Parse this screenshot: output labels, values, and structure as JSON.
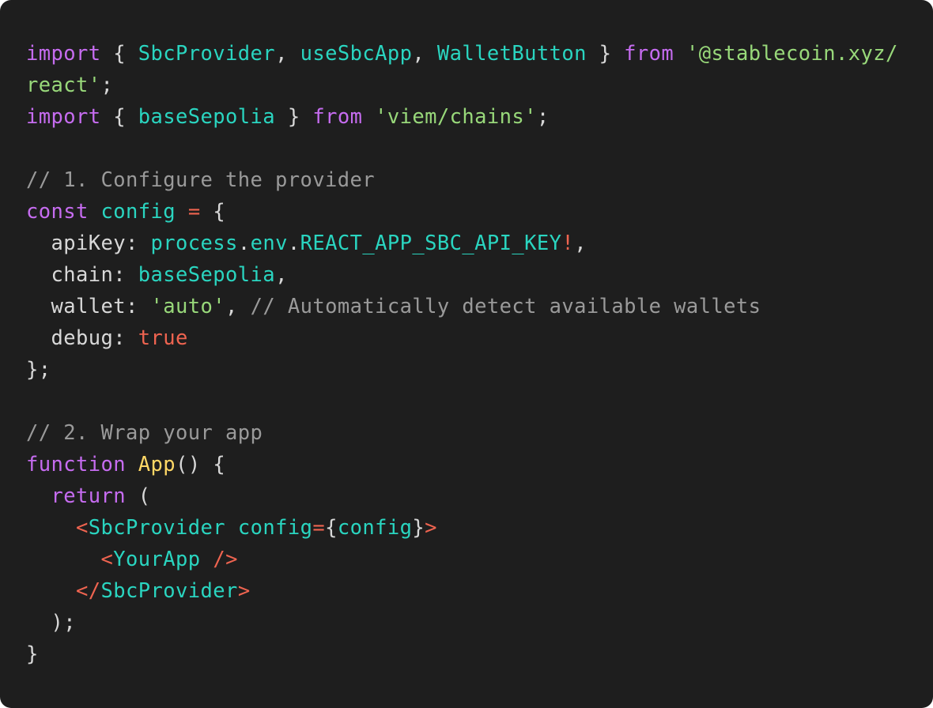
{
  "colors": {
    "background": "#1e1e1e",
    "keyword": "#c66cf0",
    "identifier": "#2ad5c0",
    "string": "#98d87a",
    "comment": "#9a9a9a",
    "plain": "#d8d8d8",
    "operator": "#ef6450",
    "function": "#ffd866"
  },
  "code_lines": [
    [
      [
        "keyword",
        "import"
      ],
      [
        "plain",
        " { "
      ],
      [
        "ident",
        "SbcProvider"
      ],
      [
        "plain",
        ", "
      ],
      [
        "ident",
        "useSbcApp"
      ],
      [
        "plain",
        ", "
      ],
      [
        "ident",
        "WalletButton"
      ],
      [
        "plain",
        " } "
      ],
      [
        "keyword",
        "from"
      ],
      [
        "plain",
        " "
      ],
      [
        "string",
        "'@stablecoin.xyz/"
      ]
    ],
    [
      [
        "string",
        "react'"
      ],
      [
        "plain",
        ";"
      ]
    ],
    [
      [
        "keyword",
        "import"
      ],
      [
        "plain",
        " { "
      ],
      [
        "ident",
        "baseSepolia"
      ],
      [
        "plain",
        " } "
      ],
      [
        "keyword",
        "from"
      ],
      [
        "plain",
        " "
      ],
      [
        "string",
        "'viem/chains'"
      ],
      [
        "plain",
        ";"
      ]
    ],
    [],
    [
      [
        "comment",
        "// 1. Configure the provider"
      ]
    ],
    [
      [
        "keyword",
        "const"
      ],
      [
        "plain",
        " "
      ],
      [
        "ident",
        "config"
      ],
      [
        "plain",
        " "
      ],
      [
        "op",
        "="
      ],
      [
        "plain",
        " {"
      ]
    ],
    [
      [
        "plain",
        "  apiKey: "
      ],
      [
        "ident",
        "process"
      ],
      [
        "plain",
        "."
      ],
      [
        "ident",
        "env"
      ],
      [
        "plain",
        "."
      ],
      [
        "ident",
        "REACT_APP_SBC_API_KEY"
      ],
      [
        "op",
        "!"
      ],
      [
        "plain",
        ","
      ]
    ],
    [
      [
        "plain",
        "  chain: "
      ],
      [
        "ident",
        "baseSepolia"
      ],
      [
        "plain",
        ","
      ]
    ],
    [
      [
        "plain",
        "  wallet: "
      ],
      [
        "string",
        "'auto'"
      ],
      [
        "plain",
        ", "
      ],
      [
        "comment",
        "// Automatically detect available wallets"
      ]
    ],
    [
      [
        "plain",
        "  debug: "
      ],
      [
        "op",
        "true"
      ]
    ],
    [
      [
        "plain",
        "};"
      ]
    ],
    [],
    [
      [
        "comment",
        "// 2. Wrap your app"
      ]
    ],
    [
      [
        "keyword",
        "function"
      ],
      [
        "plain",
        " "
      ],
      [
        "func",
        "App"
      ],
      [
        "plain",
        "() {"
      ]
    ],
    [
      [
        "plain",
        "  "
      ],
      [
        "keyword",
        "return"
      ],
      [
        "plain",
        " ("
      ]
    ],
    [
      [
        "plain",
        "    "
      ],
      [
        "tag",
        "<"
      ],
      [
        "ident",
        "SbcProvider"
      ],
      [
        "plain",
        " "
      ],
      [
        "ident",
        "config"
      ],
      [
        "op",
        "="
      ],
      [
        "plain",
        "{"
      ],
      [
        "ident",
        "config"
      ],
      [
        "plain",
        "}"
      ],
      [
        "tag",
        ">"
      ]
    ],
    [
      [
        "plain",
        "      "
      ],
      [
        "tag",
        "<"
      ],
      [
        "ident",
        "YourApp"
      ],
      [
        "plain",
        " "
      ],
      [
        "tag",
        "/>"
      ]
    ],
    [
      [
        "plain",
        "    "
      ],
      [
        "tag",
        "</"
      ],
      [
        "ident",
        "SbcProvider"
      ],
      [
        "tag",
        ">"
      ]
    ],
    [
      [
        "plain",
        "  );"
      ]
    ],
    [
      [
        "plain",
        "}"
      ]
    ]
  ]
}
